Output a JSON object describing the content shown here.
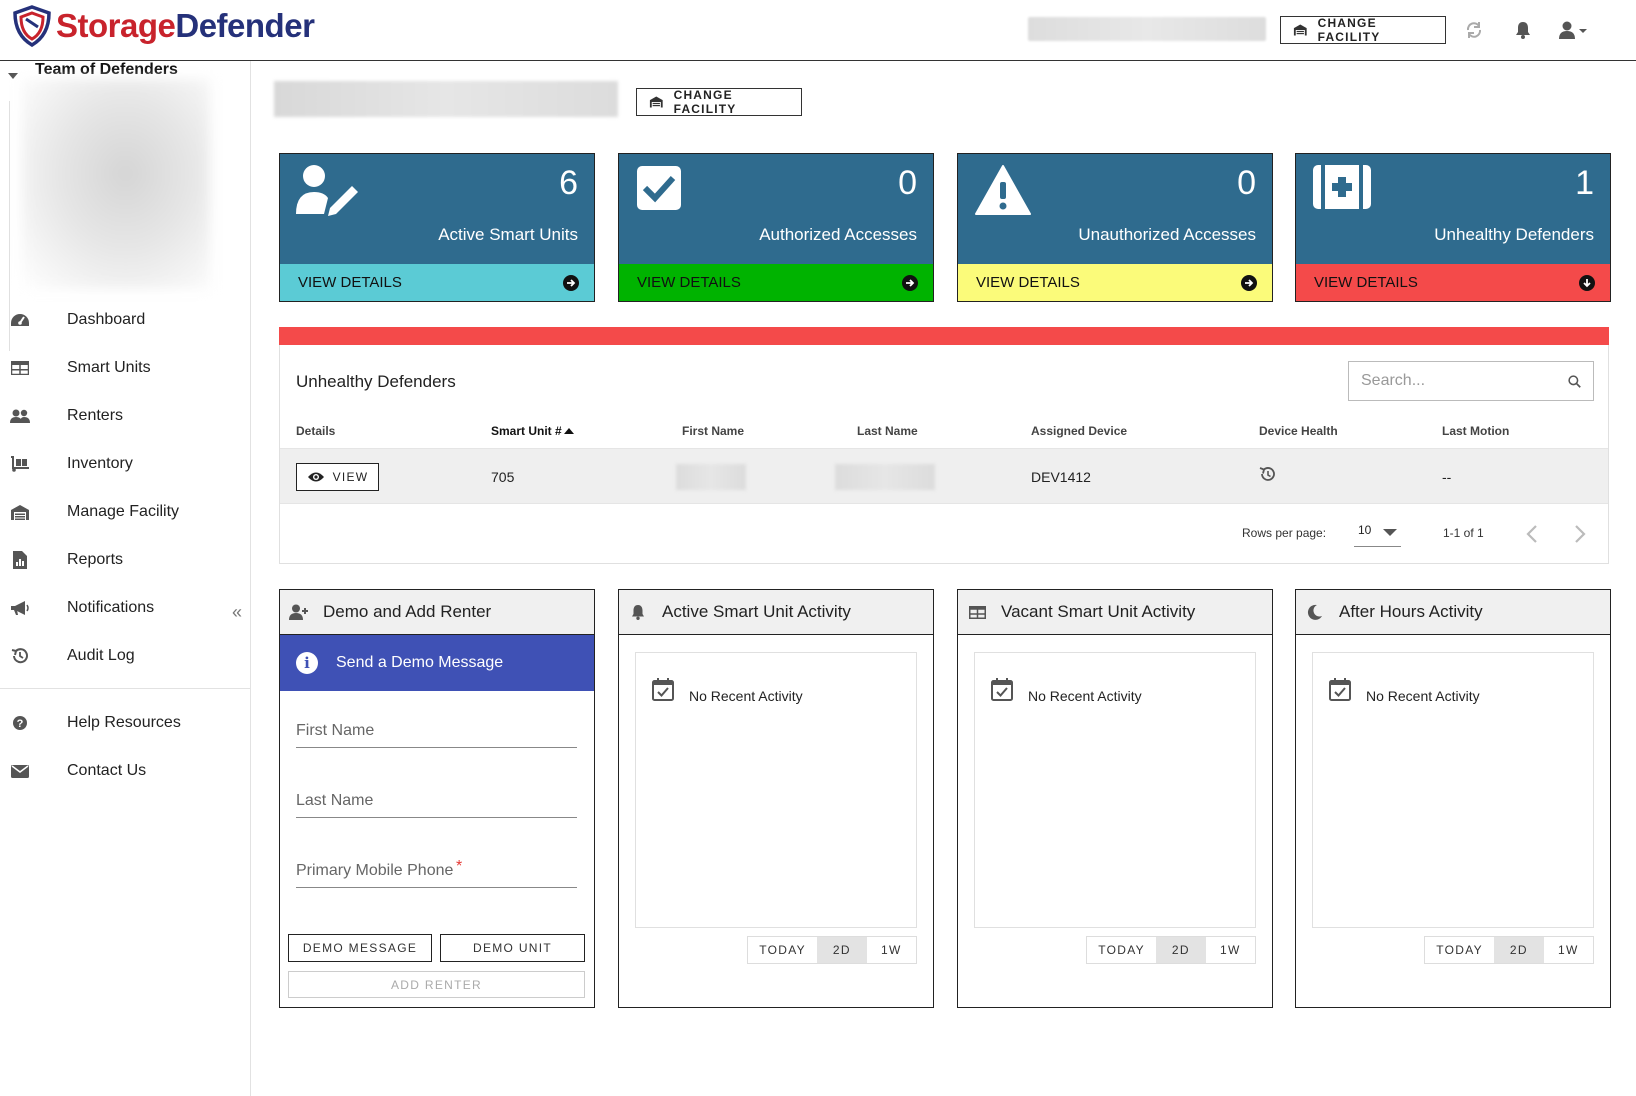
{
  "brand": {
    "word1": "Storage",
    "word2": "Defender",
    "primary": "#c8232c",
    "secondary": "#25317a"
  },
  "header": {
    "change_facility": "CHANGE FACILITY"
  },
  "sidebar": {
    "team_name": "Team of Defenders",
    "items": [
      {
        "label": "Dashboard",
        "icon": "dashboard-icon"
      },
      {
        "label": "Smart Units",
        "icon": "grid-icon"
      },
      {
        "label": "Renters",
        "icon": "users-icon"
      },
      {
        "label": "Inventory",
        "icon": "dolly-icon"
      },
      {
        "label": "Manage Facility",
        "icon": "warehouse-icon"
      },
      {
        "label": "Reports",
        "icon": "report-icon"
      },
      {
        "label": "Notifications",
        "icon": "bullhorn-icon"
      },
      {
        "label": "Audit Log",
        "icon": "history-icon"
      }
    ],
    "help_items": [
      {
        "label": "Help Resources",
        "icon": "question-icon"
      },
      {
        "label": "Contact Us",
        "icon": "envelope-icon"
      }
    ],
    "collapse": "«"
  },
  "main": {
    "change_facility": "CHANGE FACILITY",
    "stats": [
      {
        "value": "6",
        "label": "Active Smart Units",
        "footer": "VIEW DETAILS",
        "footer_color": "#5bcbd5",
        "icon": "user-edit-icon"
      },
      {
        "value": "0",
        "label": "Authorized Accesses",
        "footer": "VIEW DETAILS",
        "footer_color": "#00b300",
        "icon": "check-square-icon"
      },
      {
        "value": "0",
        "label": "Unauthorized Accesses",
        "footer": "VIEW DETAILS",
        "footer_color": "#fbfb7a",
        "icon": "warning-icon"
      },
      {
        "value": "1",
        "label": "Unhealthy Defenders",
        "footer": "VIEW DETAILS",
        "footer_color": "#f44a4a",
        "icon": "first-aid-icon"
      }
    ],
    "table": {
      "title": "Unhealthy Defenders",
      "search_placeholder": "Search...",
      "columns": [
        "Details",
        "Smart Unit #",
        "First Name",
        "Last Name",
        "Assigned Device",
        "Device Health",
        "Last Motion"
      ],
      "rows": [
        {
          "details": "VIEW",
          "unit": "705",
          "device": "DEV1412",
          "last_motion": "--"
        }
      ],
      "rows_per_page_label": "Rows per page:",
      "rows_per_page": "10",
      "range": "1-1 of 1"
    },
    "panels": {
      "demo": {
        "title": "Demo and Add Renter",
        "banner": "Send a Demo Message",
        "first_name": "First Name",
        "last_name": "Last Name",
        "phone": "Primary Mobile Phone",
        "required": "*",
        "demo_message": "DEMO MESSAGE",
        "demo_unit": "DEMO UNIT",
        "add_renter": "ADD RENTER"
      },
      "activity": [
        {
          "title": "Active Smart Unit Activity",
          "icon": "bell-icon",
          "empty": "No Recent Activity"
        },
        {
          "title": "Vacant Smart Unit Activity",
          "icon": "table-icon",
          "empty": "No Recent Activity"
        },
        {
          "title": "After Hours Activity",
          "icon": "moon-icon",
          "empty": "No Recent Activity"
        }
      ],
      "ranges": [
        "TODAY",
        "2D",
        "1W"
      ],
      "active_range": "2D"
    }
  }
}
